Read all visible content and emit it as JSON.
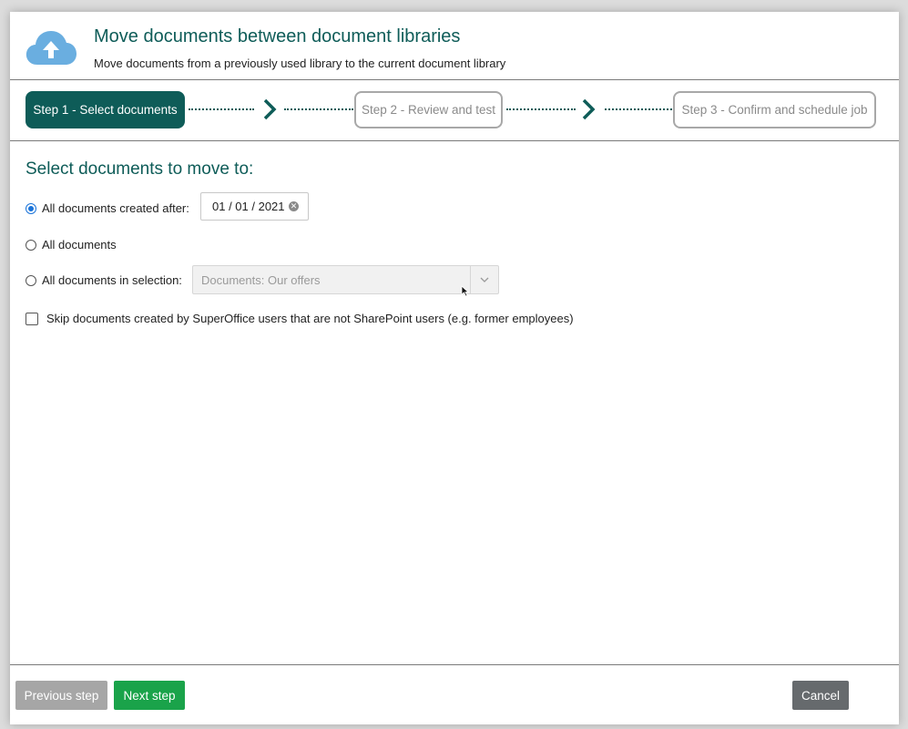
{
  "header": {
    "title": "Move documents between document libraries",
    "subtitle": "Move documents from a previously used library to the current document library",
    "icon": "cloud-upload-icon"
  },
  "steps": [
    {
      "label": "Step 1 - Select documents",
      "state": "active"
    },
    {
      "label": "Step 2 - Review and test",
      "state": "inactive"
    },
    {
      "label": "Step 3 - Confirm and schedule job",
      "state": "inactive"
    }
  ],
  "main": {
    "section_title": "Select documents to move to:",
    "option_created_after": {
      "label": "All documents created after:",
      "selected": true,
      "date_value": "01 / 01 / 2021"
    },
    "option_all": {
      "label": "All documents",
      "selected": false
    },
    "option_selection": {
      "label": "All documents in selection:",
      "selected": false,
      "select_value": "Documents: Our offers"
    },
    "skip_checkbox": {
      "label": "Skip documents created by SuperOffice users that are not SharePoint users (e.g. former employees)",
      "checked": false
    }
  },
  "footer": {
    "previous_label": "Previous step",
    "next_label": "Next step",
    "cancel_label": "Cancel"
  },
  "colors": {
    "accent": "#0e5c58",
    "next_button": "#1aa34a",
    "previous_button": "#a6a6a6",
    "cancel_button": "#666a6d",
    "radio_selected": "#1a73d9"
  }
}
